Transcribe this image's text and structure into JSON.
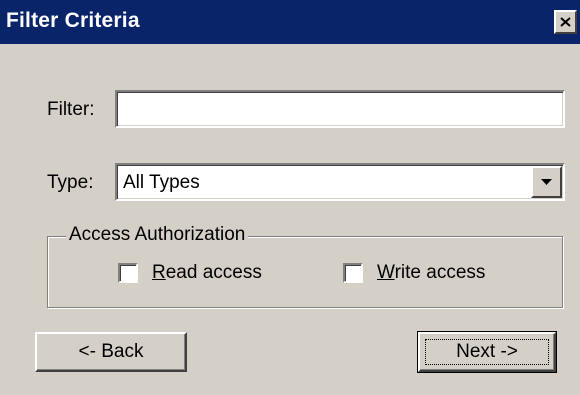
{
  "dialog": {
    "title": "Filter Criteria"
  },
  "filter": {
    "label": "Filter:",
    "value": ""
  },
  "type": {
    "label": "Type:",
    "selected": "All Types"
  },
  "access": {
    "legend": "Access Authorization",
    "read": {
      "accel": "R",
      "rest": "ead access",
      "checked": false
    },
    "write": {
      "accel": "W",
      "rest": "rite access",
      "checked": false
    }
  },
  "buttons": {
    "back": "<- Back",
    "next": "Next ->"
  },
  "icons": {
    "close": "close-icon",
    "dropdown": "chevron-down-icon"
  },
  "colors": {
    "titlebar": "#0a246a",
    "face": "#d4d0c8"
  }
}
